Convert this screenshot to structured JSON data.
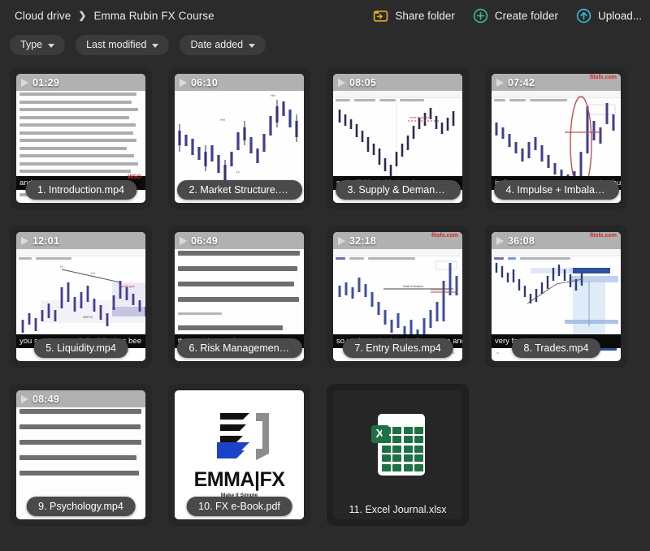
{
  "app": {
    "background_color": "#2b2b2b",
    "card_color": "#262626",
    "accent_upload": "#35bcd8",
    "accent_create": "#3fbf7f",
    "accent_share": "#e0a92b"
  },
  "breadcrumb": {
    "root": "Cloud drive",
    "separator": "›",
    "current": "Emma Rubin FX Course"
  },
  "toolbar": {
    "share_label": "Share folder",
    "share_icon": "share-folder-icon",
    "create_label": "Create folder",
    "create_icon": "plus-circle-icon",
    "upload_label": "Upload...",
    "upload_icon": "upload-circle-icon"
  },
  "filters": [
    {
      "label": "Type",
      "icon": "chevron-down-icon"
    },
    {
      "label": "Last modified",
      "icon": "chevron-down-icon"
    },
    {
      "label": "Date added",
      "icon": "chevron-down-icon"
    }
  ],
  "files": [
    {
      "name": "1. Introduction.mp4",
      "duration": "01:29",
      "kind": "video",
      "thumb": "document",
      "watermark": "WSO",
      "subtitle": "and v"
    },
    {
      "name": "2. Market Structure.m...",
      "duration": "06:10",
      "kind": "video",
      "thumb": "chart",
      "watermark": "",
      "subtitle": ""
    },
    {
      "name": "3. Supply & Demand....",
      "duration": "08:05",
      "kind": "video",
      "thumb": "chart",
      "watermark": "",
      "subtitle": "so I will Mark this break"
    },
    {
      "name": "4. Impulse + Imbalanc...",
      "duration": "07:42",
      "kind": "video",
      "thumb": "chart",
      "watermark": "fitsfx.com",
      "subtitle": "indicates a very strong power that buye"
    },
    {
      "name": "5. Liquidity.mp4",
      "duration": "12:01",
      "kind": "video",
      "thumb": "chart",
      "watermark": "",
      "subtitle": "you see how much liquidity has bee"
    },
    {
      "name": "6. Risk Management....",
      "duration": "06:49",
      "kind": "video",
      "thumb": "document",
      "watermark": "",
      "subtitle": "that you know when to stop"
    },
    {
      "name": "7. Entry Rules.mp4",
      "duration": "32:18",
      "kind": "video",
      "thumb": "chart",
      "watermark": "fitsfx.com",
      "subtitle": "so we have the break of structure and th"
    },
    {
      "name": "8. Trades.mp4",
      "duration": "36:08",
      "kind": "video",
      "thumb": "chart",
      "watermark": "fitsfx.com",
      "subtitle": "very fast"
    },
    {
      "name": "9. Psychology.mp4",
      "duration": "08:49",
      "kind": "video",
      "thumb": "document",
      "watermark": "",
      "subtitle": ""
    },
    {
      "name": "10. FX e-Book.pdf",
      "duration": "",
      "kind": "pdf",
      "thumb": "pdf-cover",
      "brand": "EMMA|FX",
      "tagline": "Make It Simple"
    },
    {
      "name": "11. Excel Journal.xlsx",
      "duration": "",
      "kind": "spreadsheet",
      "thumb": "excel-icon",
      "icon_letter": "X"
    }
  ]
}
